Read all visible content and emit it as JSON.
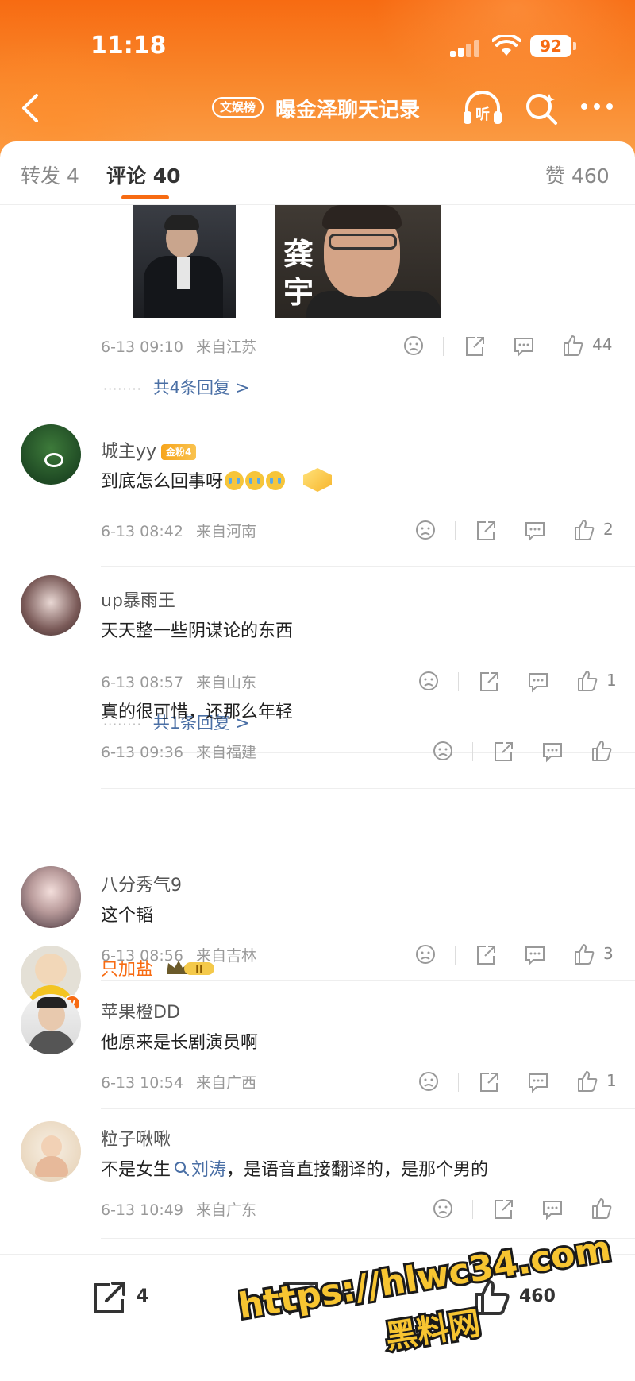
{
  "status_bar": {
    "time": "11:18",
    "battery": "92"
  },
  "nav": {
    "badge": "文娱榜",
    "title": "曝金泽聊天记录",
    "listen_label": "听"
  },
  "tabs": {
    "repost": "转发 4",
    "comment": "评论 40",
    "likes": "赞 460"
  },
  "top_comment": {
    "photo_caption": "龚宇",
    "time": "6-13 09:10",
    "location": "来自江苏",
    "likes": "44",
    "replies": "共4条回复 >"
  },
  "comments": [
    {
      "user": "城主yy",
      "badge": "金粉4",
      "text": "到底怎么回事呀",
      "time": "6-13 08:42",
      "location": "来自河南",
      "likes": "2"
    },
    {
      "user": "up暴雨王",
      "text": "天天整一些阴谋论的东西",
      "time": "6-13 08:57",
      "location": "来自山东",
      "likes": "1",
      "replies": "共1条回复 >"
    },
    {
      "user": "只加盐",
      "badge": "II",
      "text": "真的很可惜，还那么年轻",
      "time": "6-13 09:36",
      "location": "来自福建",
      "likes": ""
    },
    {
      "user": "八分秀气9",
      "text": "这个韬",
      "time": "6-13 08:56",
      "location": "来自吉林",
      "likes": "3"
    },
    {
      "user": "苹果橙DD",
      "text": "他原来是长剧演员啊",
      "time": "6-13 10:54",
      "location": "来自广西",
      "likes": "1"
    },
    {
      "user": "粒子啾啾",
      "text_before": "不是女生",
      "mention": "刘涛",
      "text_after": "，是语音直接翻译的，是那个男的",
      "time": "6-13 10:49",
      "location": "来自广东",
      "likes": ""
    }
  ],
  "bottom_bar": {
    "repost_count": "4",
    "comment_count": "40",
    "like_count": "460"
  },
  "watermark": {
    "line1": "https://hlwc34.com",
    "line2": "黑料网"
  },
  "colors": {
    "accent": "#f76b12",
    "link": "#4a6fa5"
  },
  "icons": [
    "back-icon",
    "listen-icon",
    "search-icon",
    "more-icon",
    "dislike-icon",
    "share-icon",
    "comment-icon",
    "like-icon"
  ]
}
